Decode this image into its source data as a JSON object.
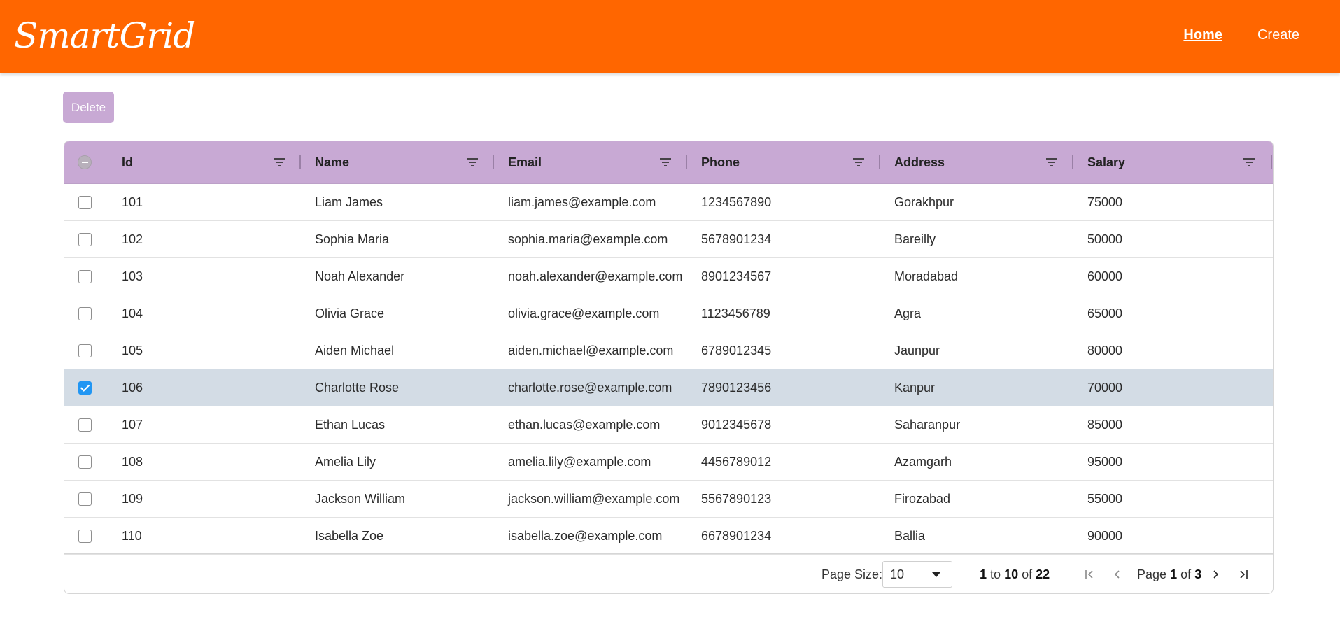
{
  "app": {
    "logo": "SmartGrid"
  },
  "nav": {
    "home": "Home",
    "create": "Create"
  },
  "toolbar": {
    "delete_label": "Delete"
  },
  "grid": {
    "columns": [
      "Id",
      "Name",
      "Email",
      "Phone",
      "Address",
      "Salary"
    ],
    "rows": [
      {
        "id": "101",
        "name": "Liam James",
        "email": "liam.james@example.com",
        "phone": "1234567890",
        "address": "Gorakhpur",
        "salary": "75000",
        "selected": false
      },
      {
        "id": "102",
        "name": "Sophia Maria",
        "email": "sophia.maria@example.com",
        "phone": "5678901234",
        "address": "Bareilly",
        "salary": "50000",
        "selected": false
      },
      {
        "id": "103",
        "name": "Noah Alexander",
        "email": "noah.alexander@example.com",
        "phone": "8901234567",
        "address": "Moradabad",
        "salary": "60000",
        "selected": false
      },
      {
        "id": "104",
        "name": "Olivia Grace",
        "email": "olivia.grace@example.com",
        "phone": "1123456789",
        "address": "Agra",
        "salary": "65000",
        "selected": false
      },
      {
        "id": "105",
        "name": "Aiden Michael",
        "email": "aiden.michael@example.com",
        "phone": "6789012345",
        "address": "Jaunpur",
        "salary": "80000",
        "selected": false
      },
      {
        "id": "106",
        "name": "Charlotte Rose",
        "email": "charlotte.rose@example.com",
        "phone": "7890123456",
        "address": "Kanpur",
        "salary": "70000",
        "selected": true
      },
      {
        "id": "107",
        "name": "Ethan Lucas",
        "email": "ethan.lucas@example.com",
        "phone": "9012345678",
        "address": "Saharanpur",
        "salary": "85000",
        "selected": false
      },
      {
        "id": "108",
        "name": "Amelia Lily",
        "email": "amelia.lily@example.com",
        "phone": "4456789012",
        "address": "Azamgarh",
        "salary": "95000",
        "selected": false
      },
      {
        "id": "109",
        "name": "Jackson William",
        "email": "jackson.william@example.com",
        "phone": "5567890123",
        "address": "Firozabad",
        "salary": "55000",
        "selected": false
      },
      {
        "id": "110",
        "name": "Isabella Zoe",
        "email": "isabella.zoe@example.com",
        "phone": "6678901234",
        "address": "Ballia",
        "salary": "90000",
        "selected": false
      }
    ]
  },
  "pagination": {
    "page_size_label": "Page Size:",
    "page_size": "10",
    "range_start": "1",
    "range_to": "to",
    "range_end": "10",
    "range_of": "of",
    "total": "22",
    "page_label": "Page",
    "current_page": "1",
    "page_of": "of",
    "total_pages": "3"
  },
  "colors": {
    "navbar": "#ff6600",
    "header": "#c8a9d4",
    "selected_row": "#d3dce5",
    "checkbox_checked": "#2196f3"
  }
}
